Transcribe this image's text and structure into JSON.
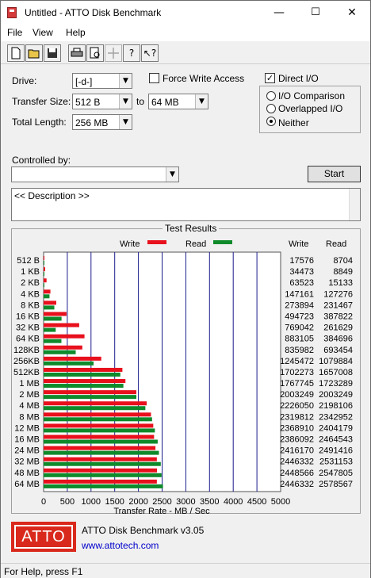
{
  "window": {
    "title": "Untitled - ATTO Disk Benchmark",
    "minimize": "—",
    "maximize": "☐",
    "close": "✕"
  },
  "menu": [
    "File",
    "View",
    "Help"
  ],
  "toolbar": [
    "new-icon",
    "open-icon",
    "save-icon",
    "print-icon",
    "print-preview-icon",
    "move-icon",
    "help-icon",
    "context-help-icon"
  ],
  "settings": {
    "drive_label": "Drive:",
    "drive_value": "[-d-]",
    "transfer_size_label": "Transfer Size:",
    "transfer_from": "512 B",
    "to_label": "to",
    "transfer_to": "64 MB",
    "total_length_label": "Total Length:",
    "total_length": "256 MB",
    "force_write_label": "Force Write Access",
    "force_write_checked": false,
    "direct_io_label": "Direct I/O",
    "direct_io_checked": true,
    "io_options": [
      {
        "label": "I/O Comparison",
        "selected": false
      },
      {
        "label": "Overlapped I/O",
        "selected": false
      },
      {
        "label": "Neither",
        "selected": true
      }
    ],
    "controlled_by_label": "Controlled by:",
    "controlled_by_value": "",
    "start_label": "Start",
    "description": "<< Description >>"
  },
  "results": {
    "title": "Test Results",
    "legend_write": "Write",
    "legend_read": "Read",
    "col_write": "Write",
    "col_read": "Read",
    "write_color": "#e8101c",
    "read_color": "#0e8a2b"
  },
  "chart_data": {
    "type": "bar",
    "orientation": "horizontal",
    "xlabel": "Transfer Rate - MB / Sec",
    "xlim": [
      0,
      5000
    ],
    "xticks": [
      0,
      500,
      1000,
      1500,
      2000,
      2500,
      3000,
      3500,
      4000,
      4500,
      5000
    ],
    "categories": [
      "512 B",
      "1 KB",
      "2 KB",
      "4 KB",
      "8 KB",
      "16 KB",
      "32 KB",
      "64 KB",
      "128KB",
      "256KB",
      "512KB",
      "1 MB",
      "2 MB",
      "4 MB",
      "8 MB",
      "12 MB",
      "16 MB",
      "24 MB",
      "32 MB",
      "48 MB",
      "64 MB"
    ],
    "series": [
      {
        "name": "Write",
        "values_kb": [
          17576,
          34473,
          63523,
          147161,
          273894,
          494723,
          769042,
          883105,
          835982,
          1245472,
          1702273,
          1767745,
          2003249,
          2226050,
          2319812,
          2368910,
          2386092,
          2416170,
          2446332,
          2448566,
          2446332
        ]
      },
      {
        "name": "Read",
        "values_kb": [
          8704,
          8849,
          15133,
          127276,
          231467,
          387822,
          261629,
          384696,
          693454,
          1079884,
          1657008,
          1723289,
          2003249,
          2198106,
          2342952,
          2404179,
          2464543,
          2491416,
          2531153,
          2547805,
          2578567
        ]
      }
    ],
    "grid": true
  },
  "footer": {
    "logo_text": "ATTO",
    "product": "ATTO Disk Benchmark v3.05",
    "link": "www.attotech.com"
  },
  "status": "For Help, press F1"
}
